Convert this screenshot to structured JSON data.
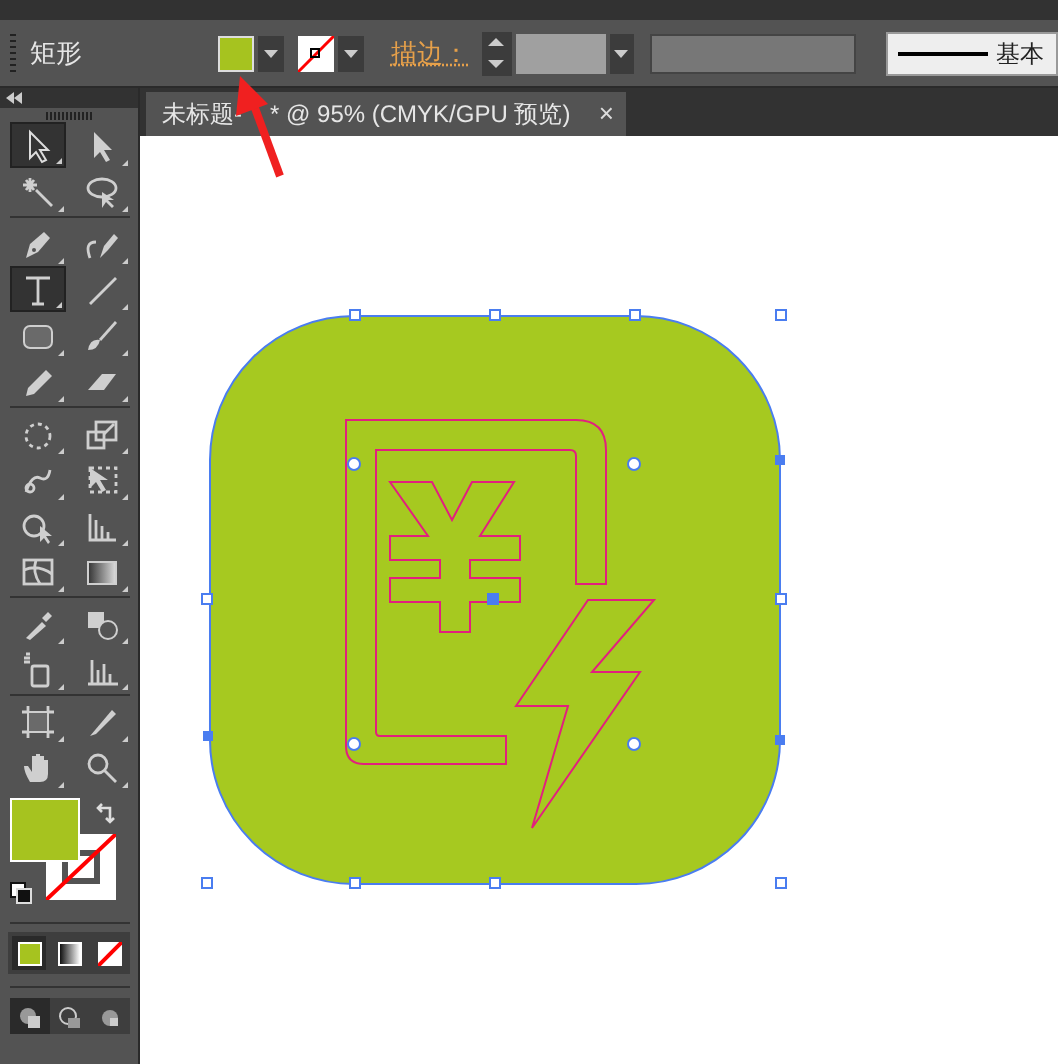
{
  "control_bar": {
    "object_label": "矩形",
    "stroke_label": "描边：",
    "brush_label": "基本"
  },
  "document_tab": {
    "title_visible_start": "未标题-",
    "title_visible_end": "* @ 95% (CMYK/GPU 预览)",
    "close": "×"
  },
  "tools": [
    {
      "kind": "selection",
      "selected": true
    },
    {
      "kind": "direct-selection",
      "selected": false
    },
    {
      "kind": "magic-wand",
      "selected": false
    },
    {
      "kind": "lasso",
      "selected": false
    },
    {
      "kind": "pen",
      "selected": false
    },
    {
      "kind": "curvature",
      "selected": false
    },
    {
      "kind": "type",
      "selected": true
    },
    {
      "kind": "line",
      "selected": false
    },
    {
      "kind": "rectangle",
      "selected": false
    },
    {
      "kind": "paintbrush",
      "selected": false
    },
    {
      "kind": "pencil",
      "selected": false
    },
    {
      "kind": "eraser",
      "selected": false
    },
    {
      "kind": "rotate",
      "selected": false
    },
    {
      "kind": "scale",
      "selected": false
    },
    {
      "kind": "puppet-warp",
      "selected": false
    },
    {
      "kind": "free-transform",
      "selected": false
    },
    {
      "kind": "shape-builder",
      "selected": false
    },
    {
      "kind": "perspective-grid",
      "selected": false
    },
    {
      "kind": "mesh",
      "selected": false
    },
    {
      "kind": "gradient",
      "selected": false
    },
    {
      "kind": "eyedropper",
      "selected": false
    },
    {
      "kind": "blend",
      "selected": false
    },
    {
      "kind": "symbol-sprayer",
      "selected": false
    },
    {
      "kind": "column-graph",
      "selected": false
    },
    {
      "kind": "artboard",
      "selected": false
    },
    {
      "kind": "slice",
      "selected": false
    },
    {
      "kind": "hand",
      "selected": false
    },
    {
      "kind": "zoom",
      "selected": false
    }
  ],
  "color_modes": [
    {
      "kind": "color",
      "selected": true
    },
    {
      "kind": "gradient",
      "selected": false
    },
    {
      "kind": "none",
      "selected": false
    }
  ],
  "screen_modes": [
    {
      "kind": "normal",
      "selected": true
    },
    {
      "kind": "behind",
      "selected": false
    },
    {
      "kind": "inside",
      "selected": false
    }
  ]
}
